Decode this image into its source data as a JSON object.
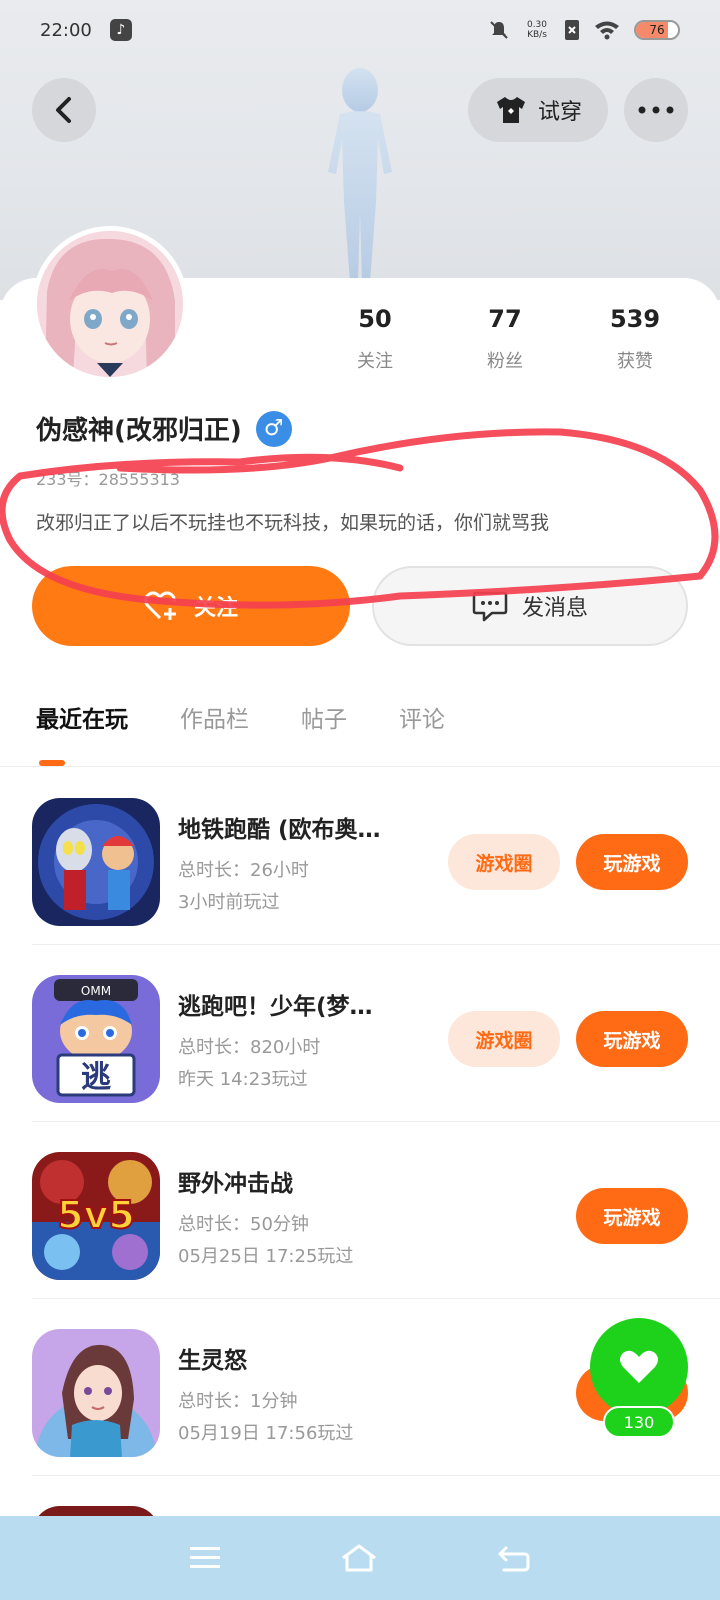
{
  "status_bar": {
    "time": "22:00",
    "net_speed": "0.30 KB/s",
    "battery": "76",
    "battery_level_pct": 76
  },
  "header": {
    "back_icon": "back-arrow-icon",
    "try_on_label": "试穿",
    "more_icon": "more-dots-icon"
  },
  "profile": {
    "name": "伪感神(改邪归正)",
    "gender_symbol": "♂",
    "uid": "233号：28555313",
    "bio": "改邪归正了以后不玩挂也不玩科技，如果玩的话，你们就骂我",
    "stats": [
      {
        "value": "50",
        "label": "关注"
      },
      {
        "value": "77",
        "label": "粉丝"
      },
      {
        "value": "539",
        "label": "获赞"
      }
    ],
    "follow_label": "关注",
    "message_label": "发消息"
  },
  "tabs": [
    {
      "label": "最近在玩",
      "active": true
    },
    {
      "label": "作品栏",
      "active": false
    },
    {
      "label": "帖子",
      "active": false
    },
    {
      "label": "评论",
      "active": false
    }
  ],
  "games": [
    {
      "title": "地铁跑酷 (欧布奥…",
      "duration": "总时长：26小时",
      "last_played": "3小时前玩过",
      "circle_label": "游戏圈",
      "play_label": "玩游戏"
    },
    {
      "title": "逃跑吧！少年(梦…",
      "duration": "总时长：820小时",
      "last_played": "昨天 14:23玩过",
      "circle_label": "游戏圈",
      "play_label": "玩游戏",
      "icon_text": "逃"
    },
    {
      "title": "野外冲击战",
      "duration": "总时长：50分钟",
      "last_played": "05月25日 17:25玩过",
      "play_label": "玩游戏",
      "icon_text": "5v5"
    },
    {
      "title": "生灵怒",
      "duration": "总时长：1分钟",
      "last_played": "05月19日 17:56玩过"
    }
  ],
  "floating_like": {
    "count": "130"
  },
  "colors": {
    "accent": "#ff6a14",
    "like_green": "#1ed21b",
    "nav_bg": "#b9dcf0",
    "scribble": "#f4404f"
  }
}
